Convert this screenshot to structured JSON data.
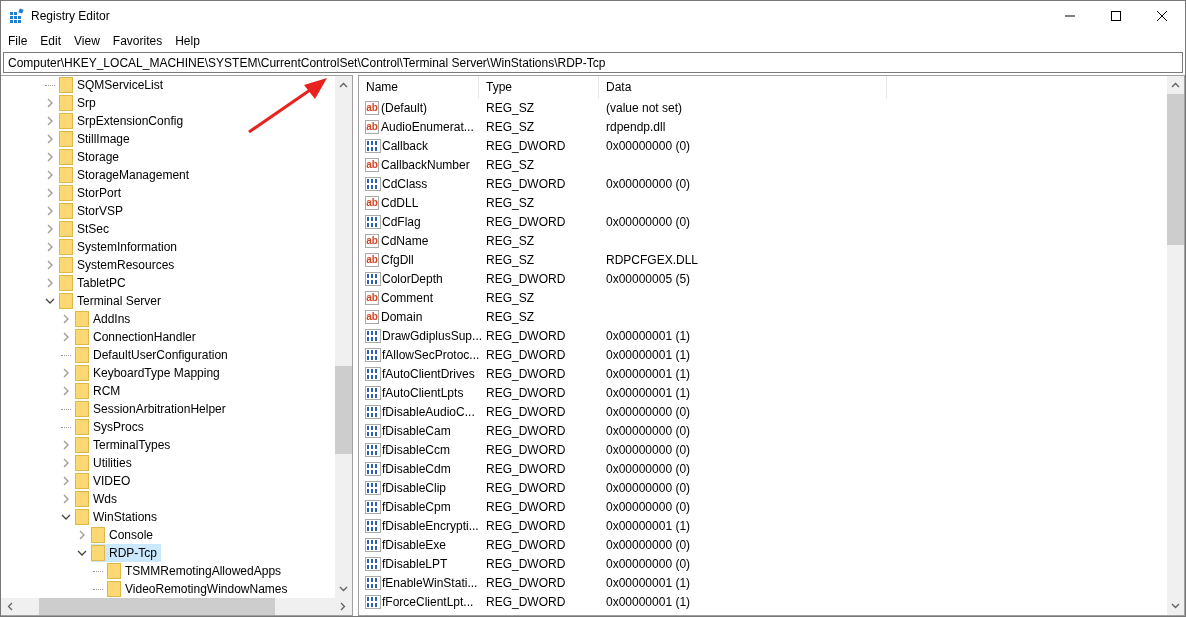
{
  "window": {
    "title": "Registry Editor"
  },
  "menu": [
    "File",
    "Edit",
    "View",
    "Favorites",
    "Help"
  ],
  "address": "Computer\\HKEY_LOCAL_MACHINE\\SYSTEM\\CurrentControlSet\\Control\\Terminal Server\\WinStations\\RDP-Tcp",
  "tree": [
    {
      "label": "SQMServiceList",
      "expandable": false,
      "expanded": false,
      "selected": false
    },
    {
      "label": "Srp",
      "expandable": true,
      "expanded": false,
      "selected": false
    },
    {
      "label": "SrpExtensionConfig",
      "expandable": true,
      "expanded": false,
      "selected": false
    },
    {
      "label": "StillImage",
      "expandable": true,
      "expanded": false,
      "selected": false
    },
    {
      "label": "Storage",
      "expandable": true,
      "expanded": false,
      "selected": false
    },
    {
      "label": "StorageManagement",
      "expandable": true,
      "expanded": false,
      "selected": false
    },
    {
      "label": "StorPort",
      "expandable": true,
      "expanded": false,
      "selected": false
    },
    {
      "label": "StorVSP",
      "expandable": true,
      "expanded": false,
      "selected": false
    },
    {
      "label": "StSec",
      "expandable": true,
      "expanded": false,
      "selected": false
    },
    {
      "label": "SystemInformation",
      "expandable": true,
      "expanded": false,
      "selected": false
    },
    {
      "label": "SystemResources",
      "expandable": true,
      "expanded": false,
      "selected": false
    },
    {
      "label": "TabletPC",
      "expandable": true,
      "expanded": false,
      "selected": false
    },
    {
      "label": "Terminal Server",
      "expandable": true,
      "expanded": true,
      "selected": false,
      "children": [
        {
          "label": "AddIns",
          "expandable": true,
          "expanded": false,
          "selected": false
        },
        {
          "label": "ConnectionHandler",
          "expandable": true,
          "expanded": false,
          "selected": false
        },
        {
          "label": "DefaultUserConfiguration",
          "expandable": false,
          "expanded": false,
          "selected": false
        },
        {
          "label": "KeyboardType Mapping",
          "expandable": true,
          "expanded": false,
          "selected": false
        },
        {
          "label": "RCM",
          "expandable": true,
          "expanded": false,
          "selected": false
        },
        {
          "label": "SessionArbitrationHelper",
          "expandable": false,
          "expanded": false,
          "selected": false
        },
        {
          "label": "SysProcs",
          "expandable": false,
          "expanded": false,
          "selected": false
        },
        {
          "label": "TerminalTypes",
          "expandable": true,
          "expanded": false,
          "selected": false
        },
        {
          "label": "Utilities",
          "expandable": true,
          "expanded": false,
          "selected": false
        },
        {
          "label": "VIDEO",
          "expandable": true,
          "expanded": false,
          "selected": false
        },
        {
          "label": "Wds",
          "expandable": true,
          "expanded": false,
          "selected": false
        },
        {
          "label": "WinStations",
          "expandable": true,
          "expanded": true,
          "selected": false,
          "children": [
            {
              "label": "Console",
              "expandable": true,
              "expanded": false,
              "selected": false
            },
            {
              "label": "RDP-Tcp",
              "expandable": true,
              "expanded": true,
              "selected": true,
              "children": [
                {
                  "label": "TSMMRemotingAllowedApps",
                  "expandable": false,
                  "expanded": false,
                  "selected": false
                },
                {
                  "label": "VideoRemotingWindowNames",
                  "expandable": false,
                  "expanded": false,
                  "selected": false
                }
              ]
            }
          ]
        }
      ]
    }
  ],
  "columns": [
    "Name",
    "Type",
    "Data"
  ],
  "values": [
    {
      "kind": "sz",
      "icon_text": "ab",
      "name": "(Default)",
      "type": "REG_SZ",
      "data": "(value not set)"
    },
    {
      "kind": "sz",
      "icon_text": "ab",
      "name": "AudioEnumerat...",
      "type": "REG_SZ",
      "data": "rdpendp.dll"
    },
    {
      "kind": "dword",
      "name": "Callback",
      "type": "REG_DWORD",
      "data": "0x00000000 (0)"
    },
    {
      "kind": "sz",
      "icon_text": "ab",
      "name": "CallbackNumber",
      "type": "REG_SZ"
    },
    {
      "kind": "dword",
      "name": "CdClass",
      "type": "REG_DWORD",
      "data": "0x00000000 (0)"
    },
    {
      "kind": "sz",
      "icon_text": "ab",
      "name": "CdDLL",
      "type": "REG_SZ"
    },
    {
      "kind": "dword",
      "name": "CdFlag",
      "type": "REG_DWORD",
      "data": "0x00000000 (0)"
    },
    {
      "kind": "sz",
      "icon_text": "ab",
      "name": "CdName",
      "type": "REG_SZ"
    },
    {
      "kind": "sz",
      "icon_text": "ab",
      "name": "CfgDll",
      "type": "REG_SZ",
      "data": "RDPCFGEX.DLL"
    },
    {
      "kind": "dword",
      "name": "ColorDepth",
      "type": "REG_DWORD",
      "data": "0x00000005 (5)"
    },
    {
      "kind": "sz",
      "icon_text": "ab",
      "name": "Comment",
      "type": "REG_SZ"
    },
    {
      "kind": "sz",
      "icon_text": "ab",
      "name": "Domain",
      "type": "REG_SZ"
    },
    {
      "kind": "dword",
      "name": "DrawGdiplusSup...",
      "type": "REG_DWORD",
      "data": "0x00000001 (1)"
    },
    {
      "kind": "dword",
      "name": "fAllowSecProtoc...",
      "type": "REG_DWORD",
      "data": "0x00000001 (1)"
    },
    {
      "kind": "dword",
      "name": "fAutoClientDrives",
      "type": "REG_DWORD",
      "data": "0x00000001 (1)"
    },
    {
      "kind": "dword",
      "name": "fAutoClientLpts",
      "type": "REG_DWORD",
      "data": "0x00000001 (1)"
    },
    {
      "kind": "dword",
      "name": "fDisableAudioC...",
      "type": "REG_DWORD",
      "data": "0x00000000 (0)"
    },
    {
      "kind": "dword",
      "name": "fDisableCam",
      "type": "REG_DWORD",
      "data": "0x00000000 (0)"
    },
    {
      "kind": "dword",
      "name": "fDisableCcm",
      "type": "REG_DWORD",
      "data": "0x00000000 (0)"
    },
    {
      "kind": "dword",
      "name": "fDisableCdm",
      "type": "REG_DWORD",
      "data": "0x00000000 (0)"
    },
    {
      "kind": "dword",
      "name": "fDisableClip",
      "type": "REG_DWORD",
      "data": "0x00000000 (0)"
    },
    {
      "kind": "dword",
      "name": "fDisableCpm",
      "type": "REG_DWORD",
      "data": "0x00000000 (0)"
    },
    {
      "kind": "dword",
      "name": "fDisableEncrypti...",
      "type": "REG_DWORD",
      "data": "0x00000001 (1)"
    },
    {
      "kind": "dword",
      "name": "fDisableExe",
      "type": "REG_DWORD",
      "data": "0x00000000 (0)"
    },
    {
      "kind": "dword",
      "name": "fDisableLPT",
      "type": "REG_DWORD",
      "data": "0x00000000 (0)"
    },
    {
      "kind": "dword",
      "name": "fEnableWinStati...",
      "type": "REG_DWORD",
      "data": "0x00000001 (1)"
    },
    {
      "kind": "dword",
      "name": "fForceClientLpt...",
      "type": "REG_DWORD",
      "data": "0x00000001 (1)"
    }
  ]
}
